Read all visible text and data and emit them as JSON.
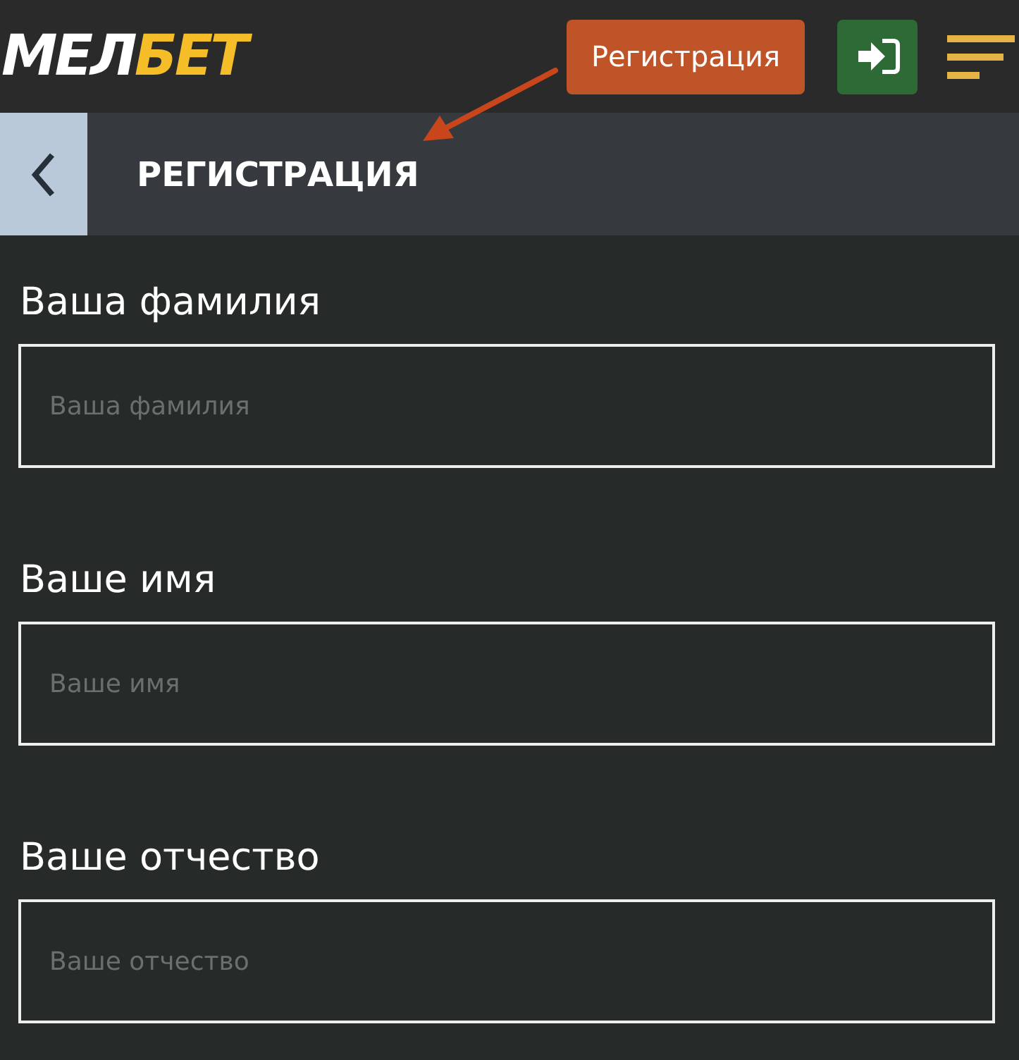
{
  "header": {
    "logo": [
      {
        "text": "МЕЛ",
        "kind": "plain"
      },
      {
        "text": "БЕТ",
        "kind": "accent"
      }
    ],
    "register_button": "Регистрация"
  },
  "page": {
    "title": "РЕГИСТРАЦИЯ"
  },
  "form": {
    "fields": [
      {
        "label": "Ваша фамилия",
        "placeholder": "Ваша фамилия"
      },
      {
        "label": "Ваше имя",
        "placeholder": "Ваше имя"
      },
      {
        "label": "Ваше отчество",
        "placeholder": "Ваше отчество"
      }
    ]
  }
}
